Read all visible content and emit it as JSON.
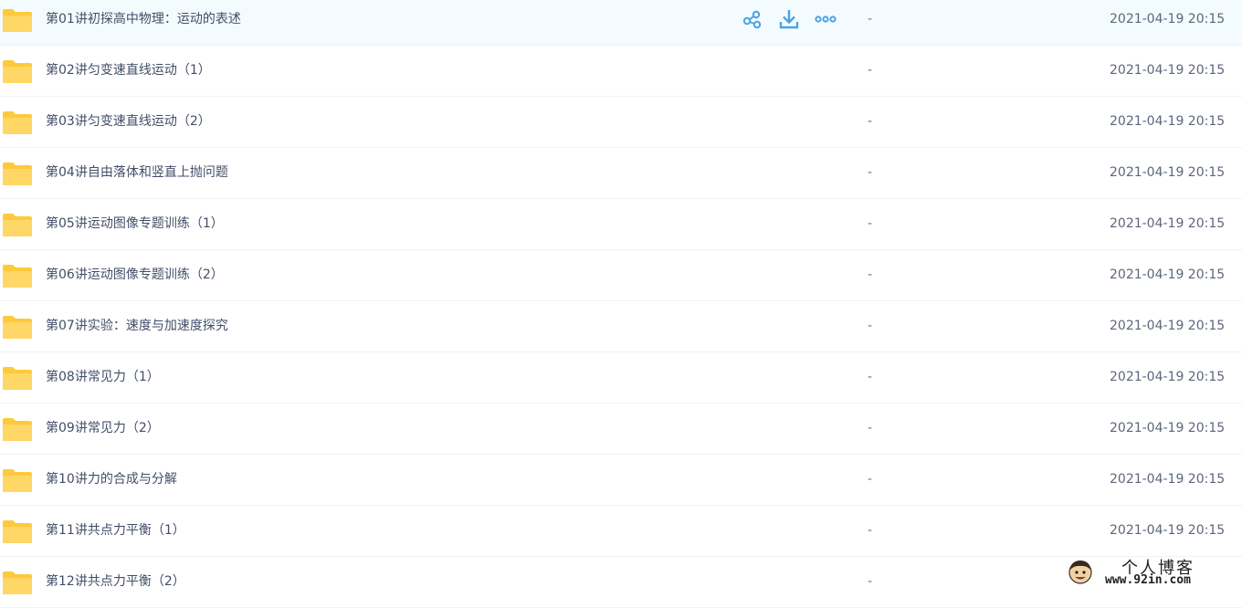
{
  "colors": {
    "accent": "#4aa3e6",
    "folder": "#ffd45a",
    "hover_bg": "#f4fbff"
  },
  "row_actions": {
    "share_icon": "share-icon",
    "download_icon": "download-icon",
    "more_icon": "more-icon"
  },
  "files": [
    {
      "name": "第01讲初探高中物理：运动的表述",
      "size": "-",
      "modified": "2021-04-19 20:15"
    },
    {
      "name": "第02讲匀变速直线运动（1）",
      "size": "-",
      "modified": "2021-04-19 20:15"
    },
    {
      "name": "第03讲匀变速直线运动（2）",
      "size": "-",
      "modified": "2021-04-19 20:15"
    },
    {
      "name": "第04讲自由落体和竖直上抛问题",
      "size": "-",
      "modified": "2021-04-19 20:15"
    },
    {
      "name": "第05讲运动图像专题训练（1）",
      "size": "-",
      "modified": "2021-04-19 20:15"
    },
    {
      "name": "第06讲运动图像专题训练（2）",
      "size": "-",
      "modified": "2021-04-19 20:15"
    },
    {
      "name": "第07讲实验：速度与加速度探究",
      "size": "-",
      "modified": "2021-04-19 20:15"
    },
    {
      "name": "第08讲常见力（1）",
      "size": "-",
      "modified": "2021-04-19 20:15"
    },
    {
      "name": "第09讲常见力（2）",
      "size": "-",
      "modified": "2021-04-19 20:15"
    },
    {
      "name": "第10讲力的合成与分解",
      "size": "-",
      "modified": "2021-04-19 20:15"
    },
    {
      "name": "第11讲共点力平衡（1）",
      "size": "-",
      "modified": "2021-04-19 20:15"
    },
    {
      "name": "第12讲共点力平衡（2）",
      "size": "-",
      "modified": ""
    }
  ],
  "watermark": {
    "title": "个人博客",
    "url": "www.92in.com"
  }
}
